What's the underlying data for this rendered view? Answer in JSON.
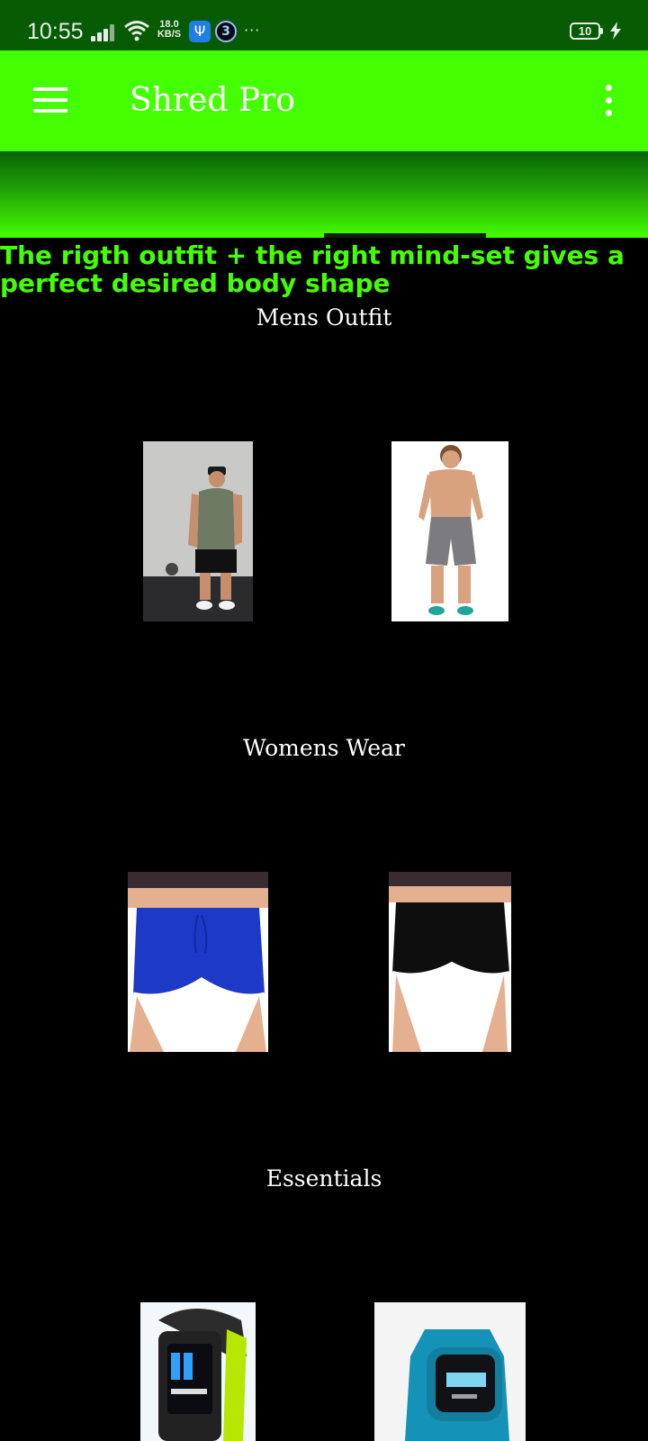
{
  "status_bar": {
    "time": "10:55",
    "net_speed_value": "18.0",
    "net_speed_unit": "KB/S",
    "battery_level": "10",
    "icons": [
      "signal-icon",
      "wifi-icon",
      "usb-icon",
      "app-notification-icon",
      "more-notifications-icon",
      "battery-icon",
      "charging-icon"
    ]
  },
  "app_bar": {
    "title": "Shred Pro",
    "left_icon": "menu-icon",
    "right_icon": "overflow-menu-icon",
    "color": "#44ff00"
  },
  "tagline": "The rigth outfit + the right mind-set gives a perfect desired body shape",
  "sections": [
    {
      "title": "Mens Outfit",
      "products": [
        {
          "image": "man-in-tank-top-and-shorts"
        },
        {
          "image": "man-in-grey-shorts"
        }
      ]
    },
    {
      "title": "Womens Wear",
      "products": [
        {
          "image": "blue-womens-shorts"
        },
        {
          "image": "black-womens-shorts"
        }
      ]
    },
    {
      "title": "Essentials",
      "products": [
        {
          "image": "fitness-band-watch"
        },
        {
          "image": "blue-smartwatch"
        }
      ]
    }
  ],
  "colors": {
    "status_bar": "#065b03",
    "accent_green": "#44ff00",
    "background": "#000000",
    "text": "#ffffff"
  }
}
